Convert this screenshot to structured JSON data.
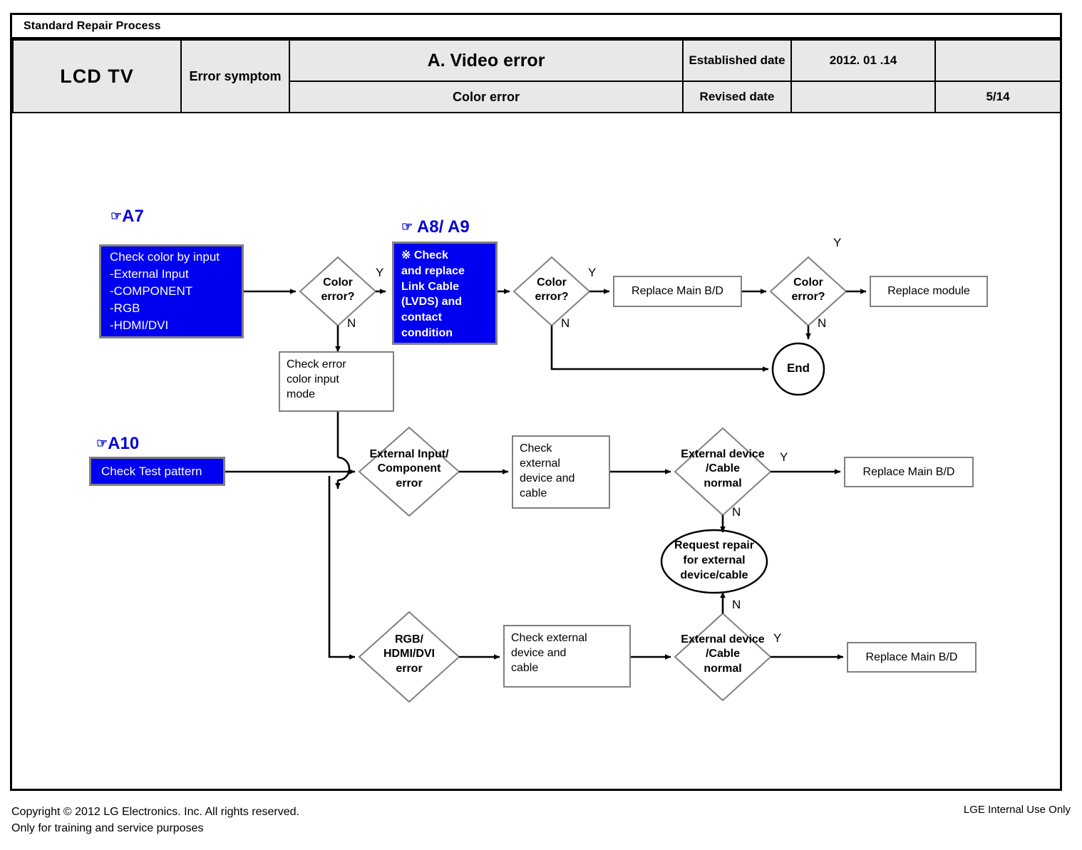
{
  "document": {
    "banner_title": "Standard Repair Process",
    "product": "LCD  TV",
    "symptom_label": "Error symptom",
    "main_title": "A. Video error",
    "sub_title": "Color error",
    "established_date_label": "Established date",
    "established_date_value": "2012. 01 .14",
    "revised_date_label": "Revised date",
    "revised_date_value": "",
    "top_right_blank": "",
    "page_number": "5/14"
  },
  "footer": {
    "copyright_line1": "Copyright © 2012 LG Electronics. Inc. All rights reserved.",
    "copyright_line2": "Only for training and service purposes",
    "confidentiality": "LGE Internal Use Only"
  },
  "colors": {
    "highlight_blue": "#0000f0",
    "reference_blue": "#0000d8",
    "box_outline_gray": "#808080",
    "header_fill": "#e8e8e8",
    "line_black": "#000000"
  },
  "references": {
    "a7": {
      "hand": "☞",
      "code": "A7"
    },
    "a89": {
      "hand": "☞",
      "code": "A8/ A9"
    },
    "a10": {
      "hand": "☞",
      "code": "A10"
    }
  },
  "flow": {
    "nodes": [
      {
        "id": "check-color-by-input",
        "type": "process-highlight",
        "lines": [
          "Check color by input",
          "-External Input",
          "-COMPONENT",
          "-RGB",
          "-HDMI/DVI"
        ]
      },
      {
        "id": "color-error-1",
        "type": "decision",
        "lines": [
          "Color",
          "error?"
        ]
      },
      {
        "id": "check-replace-link-cable",
        "type": "process-highlight",
        "lines": [
          "※ Check",
          "and replace",
          "Link Cable",
          "(LVDS) and",
          "contact",
          "condition"
        ]
      },
      {
        "id": "color-error-2",
        "type": "decision",
        "lines": [
          "Color",
          "error?"
        ]
      },
      {
        "id": "replace-main-bd-1",
        "type": "process",
        "lines": [
          "Replace Main B/D"
        ]
      },
      {
        "id": "color-error-3",
        "type": "decision",
        "lines": [
          "Color",
          "error?"
        ]
      },
      {
        "id": "replace-module",
        "type": "process",
        "lines": [
          "Replace module"
        ]
      },
      {
        "id": "end",
        "type": "terminator",
        "lines": [
          "End"
        ]
      },
      {
        "id": "check-error-color-input-mode",
        "type": "process",
        "lines": [
          "Check error",
          "color input",
          "mode"
        ]
      },
      {
        "id": "check-test-pattern",
        "type": "process-highlight",
        "lines": [
          "Check Test pattern"
        ]
      },
      {
        "id": "external-input-component-error",
        "type": "decision",
        "lines": [
          "External Input/",
          "Component",
          "error"
        ]
      },
      {
        "id": "check-external-device-cable-1",
        "type": "process",
        "lines": [
          "Check",
          "external",
          "device and",
          "cable"
        ]
      },
      {
        "id": "external-device-cable-normal-1",
        "type": "decision",
        "lines": [
          "External device",
          "/Cable",
          "normal"
        ]
      },
      {
        "id": "replace-main-bd-2",
        "type": "process",
        "lines": [
          "Replace Main B/D"
        ]
      },
      {
        "id": "request-repair",
        "type": "terminator-ellipse",
        "lines": [
          "Request repair",
          "for external",
          "device/cable"
        ]
      },
      {
        "id": "rgb-hdmi-dvi-error",
        "type": "decision",
        "lines": [
          "RGB/",
          "HDMI/DVI",
          "error"
        ]
      },
      {
        "id": "check-external-device-cable-2",
        "type": "process",
        "lines": [
          "Check external",
          "device and",
          "cable"
        ]
      },
      {
        "id": "external-device-cable-normal-2",
        "type": "decision",
        "lines": [
          "External device",
          "/Cable",
          "normal"
        ]
      },
      {
        "id": "replace-main-bd-3",
        "type": "process",
        "lines": [
          "Replace Main B/D"
        ]
      }
    ],
    "branch_labels": {
      "color_error_1_yes": "Y",
      "color_error_1_no": "N",
      "color_error_2_yes": "Y",
      "color_error_2_no": "N",
      "color_error_3_yes": "Y",
      "color_error_3_no": "N",
      "device_cable_1_yes": "Y",
      "device_cable_1_no": "N",
      "device_cable_2_yes": "Y",
      "device_cable_2_no": "N"
    }
  }
}
